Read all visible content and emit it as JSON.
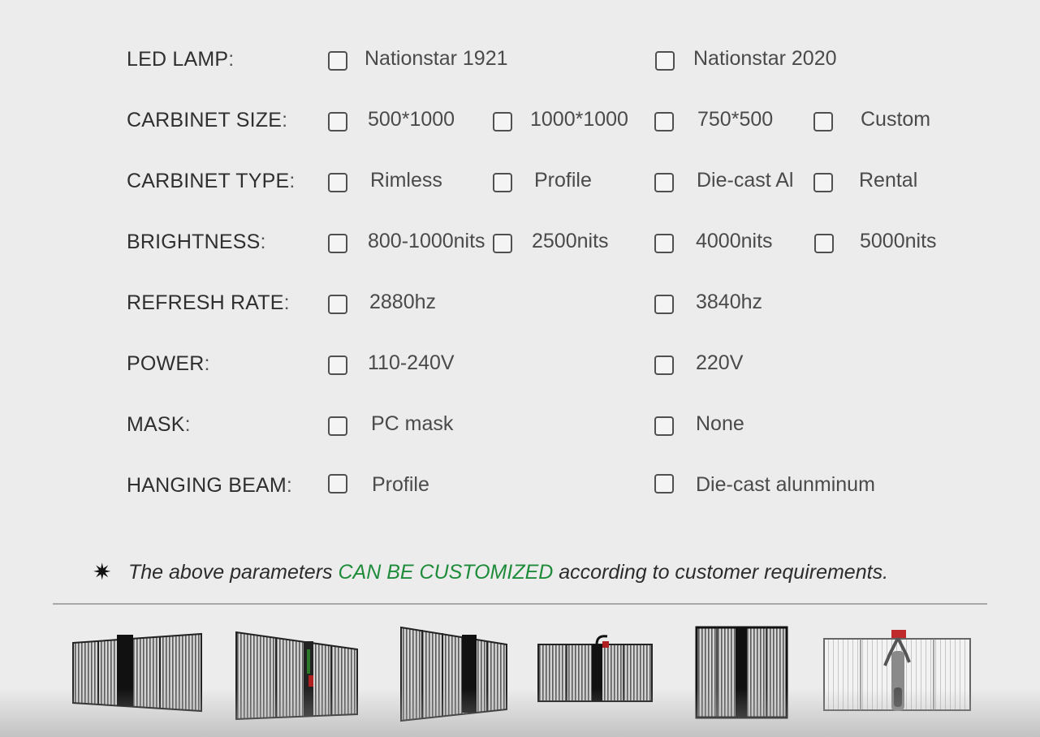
{
  "rows": [
    {
      "label": "LED LAMP",
      "colon": ":",
      "options": [
        "Nationstar 1921",
        "Nationstar 2020"
      ]
    },
    {
      "label": "CARBINET SIZE",
      "colon": ":",
      "options": [
        "500*1000",
        "1000*1000",
        "750*500",
        "Custom"
      ]
    },
    {
      "label": "CARBINET TYPE",
      "colon": ":",
      "options": [
        "Rimless",
        "Profile",
        "Die-cast Al",
        "Rental"
      ]
    },
    {
      "label": "BRIGHTNESS",
      "colon": ":",
      "options": [
        "800-1000nits",
        "2500nits",
        "4000nits",
        "5000nits"
      ]
    },
    {
      "label": "REFRESH RATE",
      "colon": ":",
      "options": [
        "2880hz",
        "3840hz"
      ]
    },
    {
      "label": "POWER",
      "colon": ":",
      "options": [
        "110-240V",
        "220V"
      ]
    },
    {
      "label": "MASK",
      "colon": ":",
      "options": [
        "PC mask",
        "None"
      ]
    },
    {
      "label": "HANGING BEAM",
      "colon": ":",
      "options": [
        "Profile",
        "Die-cast alunminum"
      ]
    }
  ],
  "note": {
    "icon": "starburst-icon",
    "before": "The above parameters ",
    "highlight": "CAN BE CUSTOMIZED",
    "after": " according to customer requirements.",
    "highlight_color": "#1e8c3a"
  },
  "products": [
    {
      "icon": "transparent-led-panel-1"
    },
    {
      "icon": "transparent-led-panel-2"
    },
    {
      "icon": "transparent-led-panel-3"
    },
    {
      "icon": "transparent-led-panel-4"
    },
    {
      "icon": "transparent-led-panel-5"
    },
    {
      "icon": "transparent-led-panel-6"
    }
  ]
}
